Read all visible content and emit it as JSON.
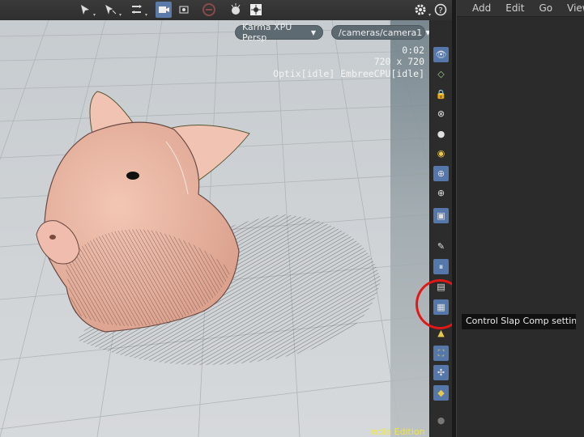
{
  "toolbar": {
    "icons": [
      "select-icon",
      "transform-icon",
      "handle-icon",
      "camera-view-icon",
      "snapshot-icon",
      "no-entry-icon",
      "light-icon",
      "sun-icon",
      "gear-icon",
      "help-icon"
    ]
  },
  "viewport": {
    "renderer_label": "Karma XPU  Persp",
    "camera_label": "/cameras/camera1",
    "hud": {
      "time": "0:02",
      "resolution": "720 x 720",
      "devices": "Optix[idle] EmbreeCPU[idle]"
    },
    "watermark": "Indie Edition"
  },
  "network_menu": {
    "items": [
      "Add",
      "Edit",
      "Go",
      "View"
    ]
  },
  "tooltip": {
    "text": "Control Slap Comp settings"
  },
  "colors": {
    "highlight_circle": "#e01818",
    "accent_blue": "#5577aa",
    "watermark": "#f1e83a"
  }
}
